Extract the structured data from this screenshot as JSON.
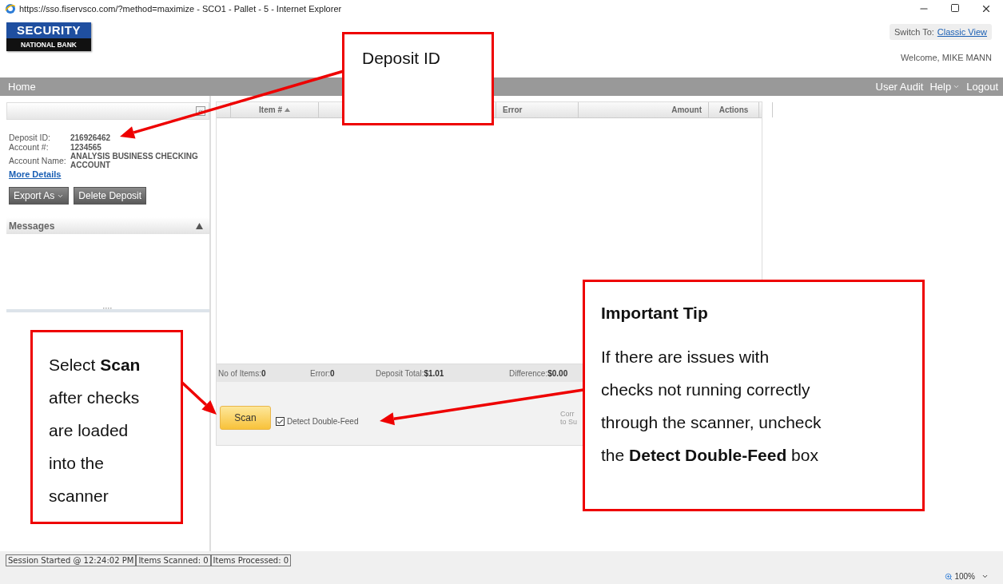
{
  "window": {
    "title": "https://sso.fiservsco.com/?method=maximize - SCO1 - Pallet - 5 - Internet Explorer"
  },
  "header": {
    "logo": {
      "line_1": "SECURITY",
      "line_2": "NATIONAL BANK"
    },
    "switch_label": "Switch To:",
    "switch_link": "Classic View",
    "welcome": "Welcome, MIKE MANN"
  },
  "nav": {
    "home": "Home",
    "items": [
      {
        "label": "User Audit",
        "dropdown": false
      },
      {
        "label": "Help",
        "dropdown": true
      },
      {
        "label": "Logout",
        "dropdown": false
      }
    ]
  },
  "sidebar": {
    "collapse_button": "«",
    "details": [
      {
        "label": "Deposit ID:",
        "value": "216926462"
      },
      {
        "label": "Account #:",
        "value": "1234565"
      },
      {
        "label": "Account Name:",
        "value": "ANALYSIS BUSINESS CHECKING ACCOUNT"
      }
    ],
    "more_details": "More Details",
    "buttons": [
      {
        "label": "Export As",
        "dropdown": true
      },
      {
        "label": "Delete Deposit",
        "dropdown": false
      }
    ],
    "messages": {
      "title": "Messages",
      "expanded": true
    }
  },
  "grid": {
    "columns": [
      {
        "label": "Item #",
        "sorted": true
      },
      {
        "label": "Error",
        "sorted": false
      },
      {
        "label": "Amount",
        "sorted": false
      },
      {
        "label": "Actions",
        "sorted": false
      }
    ],
    "summary": [
      {
        "label": "No of Items:",
        "value": "0"
      },
      {
        "label": "Error:",
        "value": "0"
      },
      {
        "label": "Deposit Total:",
        "value": "$1.01"
      },
      {
        "label": "Difference:",
        "value": "$0.00"
      }
    ],
    "scan_button": "Scan",
    "double_feed": {
      "label": "Detect Double-Feed",
      "checked": true
    },
    "cut_note": [
      "Corr",
      "to Su"
    ]
  },
  "status_bar": [
    "Session Started @ 12:24:02 PM",
    "Items Scanned: 0",
    "Items Processed: 0"
  ],
  "zoom": "100%",
  "callouts": [
    {
      "kind": "label",
      "lines": [
        "Deposit ID"
      ]
    },
    {
      "kind": "steps",
      "lines": [
        "Select **Scan**",
        "after checks",
        "are loaded",
        "into the",
        "scanner"
      ]
    },
    {
      "kind": "tip",
      "title": "Important Tip",
      "lines": [
        "If there are issues with",
        "checks not running correctly",
        "through the scanner, uncheck",
        "the **Detect Double-Feed** box"
      ]
    }
  ]
}
